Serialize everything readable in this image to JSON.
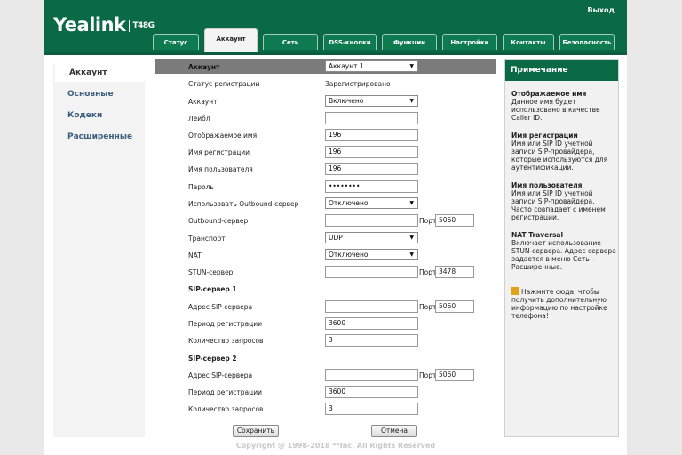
{
  "header": {
    "logo": "Yealink",
    "model": "T48G",
    "logout": "Выход"
  },
  "tabs": [
    "Статус",
    "Аккаунт",
    "Сеть",
    "DSS-кнопки",
    "Функции",
    "Настройки",
    "Контакты",
    "Безопасность"
  ],
  "sidebar": [
    "Аккаунт",
    "Основные",
    "Кодеки",
    "Расширенные"
  ],
  "form": {
    "head_label": "Аккаунт",
    "head_value": "Аккаунт 1",
    "reg_status_label": "Статус регистрации",
    "reg_status_value": "Зарегистрировано",
    "account_label": "Аккаунт",
    "account_value": "Включено",
    "label_label": "Лейбл",
    "label_value": "",
    "display_name_label": "Отображаемое имя",
    "display_name_value": "196",
    "reg_name_label": "Имя регистрации",
    "reg_name_value": "196",
    "username_label": "Имя пользователя",
    "username_value": "196",
    "password_label": "Пароль",
    "password_value": "••••••••",
    "use_outbound_label": "Использовать Outbound-сервер",
    "use_outbound_value": "Отключено",
    "outbound_label": "Outbound-сервер",
    "outbound_value": "",
    "port_label": "Порт",
    "outbound_port": "5060",
    "transport_label": "Транспорт",
    "transport_value": "UDP",
    "nat_label": "NAT",
    "nat_value": "Отключено",
    "stun_label": "STUN-сервер",
    "stun_value": "",
    "stun_port": "3478",
    "sip1_title": "SIP-сервер 1",
    "sip1_addr_label": "Адрес SIP-сервера",
    "sip1_addr_value": "",
    "sip1_port": "5060",
    "sip1_period_label": "Период регистрации",
    "sip1_period_value": "3600",
    "sip1_retries_label": "Количество запросов",
    "sip1_retries_value": "3",
    "sip2_title": "SIP-сервер 2",
    "sip2_addr_label": "Адрес SIP-сервера",
    "sip2_addr_value": "",
    "sip2_port": "5060",
    "sip2_period_label": "Период регистрации",
    "sip2_period_value": "3600",
    "sip2_retries_label": "Количество запросов",
    "sip2_retries_value": "3",
    "save_label": "Сохранить",
    "cancel_label": "Отмена"
  },
  "note": {
    "title": "Примечание",
    "items": [
      {
        "title": "Отображаемое имя",
        "text": "Данное имя будет использовано в качестве Caller ID."
      },
      {
        "title": "Имя регистрации",
        "text": "Имя или SIP ID учетной записи SIP-провайдера, которые используются для аутентификации."
      },
      {
        "title": "Имя пользователя",
        "text": "Имя или SIP ID учетной записи SIP-провайдера. Часто совпадает с именем регистрации."
      },
      {
        "title": "NAT Traversal",
        "text": "Включает использование STUN-сервера. Адрес сервера задается в меню Сеть – Расширенные."
      }
    ],
    "hint": "Нажмите сюда, чтобы получить дополнительную информацию по настройке телефона!"
  },
  "footer": {
    "copyright": "Copyright @ 1998-2018 **Inc. All Rights Reserved"
  },
  "colors": {
    "brand_green": "#0a6a46",
    "header_gray": "#7b7b7b"
  }
}
